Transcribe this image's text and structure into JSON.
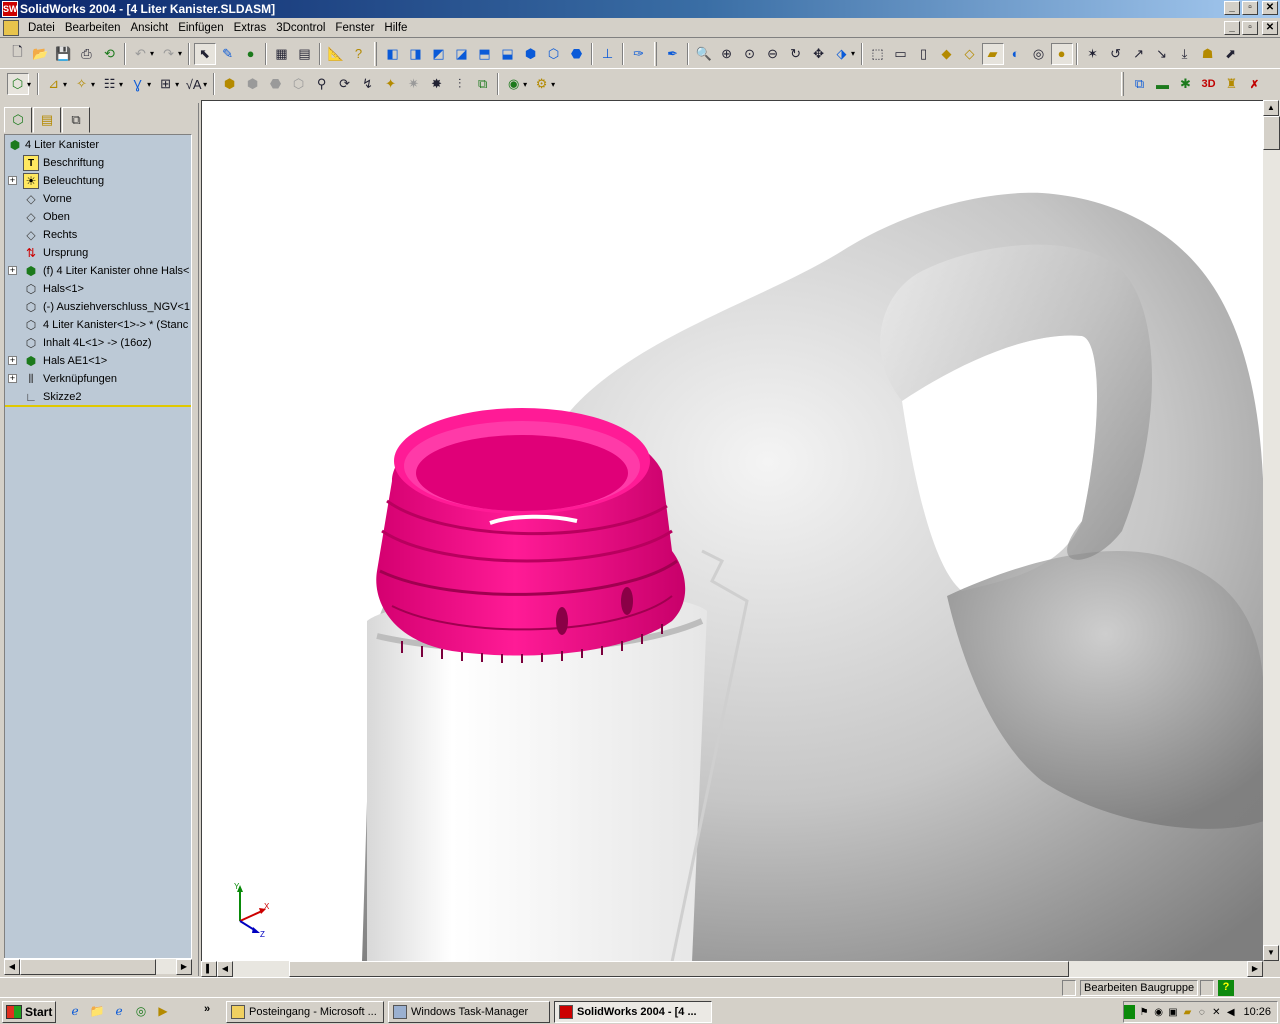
{
  "window": {
    "title": "SolidWorks 2004 - [4 Liter Kanister.SLDASM]",
    "app_icon_text": "SW",
    "minimize": "_",
    "restore": "▫",
    "close": "✕"
  },
  "menu": {
    "items": [
      "Datei",
      "Bearbeiten",
      "Ansicht",
      "Einfügen",
      "Extras",
      "3Dcontrol",
      "Fenster",
      "Hilfe"
    ]
  },
  "feature_tree": {
    "tabs": [
      "feature-manager-icon",
      "property-manager-icon",
      "configuration-manager-icon"
    ],
    "items": [
      {
        "label": "4 Liter Kanister",
        "icon": "assembly-icon",
        "expandable": false
      },
      {
        "label": "Beschriftung",
        "icon": "annotation-icon",
        "expandable": false
      },
      {
        "label": "Beleuchtung",
        "icon": "lighting-icon",
        "expandable": true
      },
      {
        "label": "Vorne",
        "icon": "plane-icon",
        "expandable": false
      },
      {
        "label": "Oben",
        "icon": "plane-icon",
        "expandable": false
      },
      {
        "label": "Rechts",
        "icon": "plane-icon",
        "expandable": false
      },
      {
        "label": "Ursprung",
        "icon": "origin-icon",
        "expandable": false
      },
      {
        "label": "(f) 4 Liter Kanister ohne Hals<",
        "icon": "subassembly-icon",
        "expandable": true
      },
      {
        "label": "Hals<1>",
        "icon": "part-icon",
        "expandable": false
      },
      {
        "label": "(-) Ausziehverschluss_NGV<1:",
        "icon": "part-icon",
        "expandable": false
      },
      {
        "label": "4 Liter Kanister<1>-> * (Stanc",
        "icon": "part-icon",
        "expandable": false
      },
      {
        "label": "Inhalt 4L<1> -> (16oz)",
        "icon": "part-icon",
        "expandable": false
      },
      {
        "label": "Hals AE1<1>",
        "icon": "subassembly-icon",
        "expandable": true
      },
      {
        "label": "Verknüpfungen",
        "icon": "mates-icon",
        "expandable": true
      },
      {
        "label": "Skizze2",
        "icon": "sketch-icon",
        "expandable": false
      }
    ]
  },
  "viewport": {
    "part_color": "#ff0b8a",
    "body_color": "#ffffff",
    "triad_labels": {
      "y": "Y",
      "x": "X",
      "z": "Z"
    }
  },
  "status_bar": {
    "mode": "Bearbeiten Baugruppe",
    "help": "?"
  },
  "taskbar": {
    "start": "Start",
    "overflow": "»",
    "tasks": [
      {
        "label": "Posteingang - Microsoft ...",
        "active": false
      },
      {
        "label": "Windows Task-Manager",
        "active": false
      },
      {
        "label": "SolidWorks 2004 - [4 ...",
        "active": true
      }
    ],
    "clock": "10:26"
  }
}
